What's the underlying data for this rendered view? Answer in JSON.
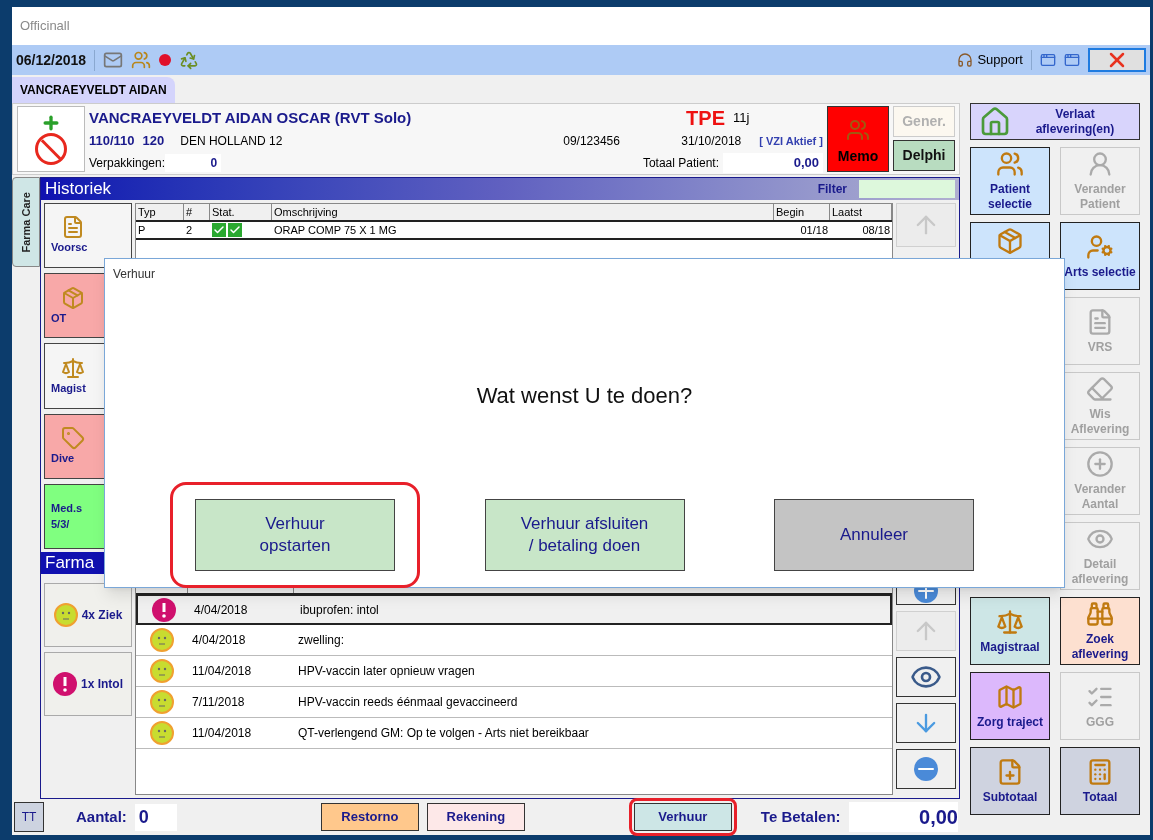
{
  "window": {
    "title": "Officinall"
  },
  "toolbar": {
    "date": "06/12/2018",
    "support": "Support"
  },
  "patient_tab": {
    "label": "VANCRAEYVELDT AIDAN",
    "selected": true
  },
  "patient": {
    "name": "VANCRAEYVELDT AIDAN OSCAR (RVT Solo)",
    "badge": "TPE",
    "age": "11j",
    "code_1": "110/110",
    "code_2": "120",
    "address": "DEN HOLLAND 12",
    "number": "09/123456",
    "date": "31/10/2018",
    "status": "[ VZI Aktief ]",
    "packages_label": "Verpakkingen:",
    "packages": "0",
    "total_label": "Totaal Patient:",
    "total": "0,00"
  },
  "header_buttons": [
    {
      "label": "Memo",
      "kind": "memo",
      "disabled": false
    },
    {
      "label": "Gener.",
      "kind": "plain",
      "disabled": true
    },
    {
      "label": "Delphi",
      "kind": "plain",
      "disabled": false
    }
  ],
  "side_tab": {
    "label": "Farma Care"
  },
  "historiek": {
    "title": "Historiek",
    "filter_label": "Filter",
    "buttons": [
      {
        "label": "Voorsc",
        "color": "#f5f5f5"
      },
      {
        "label": "OT",
        "color": "#f8a8a8"
      },
      {
        "label": "Magist",
        "color": "#f5f5f5"
      },
      {
        "label": "Dive",
        "color": "#f8a8a8"
      },
      {
        "label": "Med.s\n5/3/",
        "color": "#80ff80"
      }
    ],
    "columns": [
      "Typ",
      "#",
      "Stat.",
      "Omschrijving",
      "Begin",
      "Laatst"
    ],
    "rows": [
      {
        "typ": "P",
        "count": "2",
        "status_ok": true,
        "description": "ORAP COMP  75 X 1 MG",
        "begin": "01/18",
        "last": "08/18"
      }
    ]
  },
  "farma": {
    "title": "Farma",
    "buttons": [
      {
        "label": "4x Ziek",
        "kind": "sick"
      },
      {
        "label": "1x Intol",
        "kind": "intolerance"
      }
    ],
    "rows": [
      {
        "kind": "intolerance",
        "date": "4/04/2018",
        "text": "ibuprofen: intol",
        "selected": true
      },
      {
        "kind": "sick",
        "date": "4/04/2018",
        "text": "zwelling:",
        "selected": false
      },
      {
        "kind": "sick",
        "date": "11/04/2018",
        "text": "HPV-vaccin later opnieuw vragen",
        "selected": false
      },
      {
        "kind": "sick",
        "date": "7/11/2018",
        "text": "HPV-vaccin reeds éénmaal gevaccineerd",
        "selected": false
      },
      {
        "kind": "sick",
        "date": "11/04/2018",
        "text": "QT-verlengend GM: Op te volgen - Arts niet bereikbaar",
        "selected": false
      }
    ]
  },
  "right_panel": {
    "top": {
      "label": "Verlaat aflevering(en)",
      "color": "#d8d4fc",
      "disabled": false
    },
    "left_top": [
      {
        "label": "Patient selectie",
        "color": "#cde4fc",
        "disabled": false
      },
      {
        "color": "#cde4fc",
        "disabled": false
      }
    ],
    "left_bottom": [
      {
        "label": "Magistraal",
        "color": "#cde6e6",
        "disabled": false
      },
      {
        "label": "Zorg traject",
        "color": "#dcb8fc",
        "disabled": false
      },
      {
        "label": "Subtotaal",
        "color": "#cfd3e0",
        "disabled": false
      }
    ],
    "right": [
      {
        "label": "Verander Patient",
        "color": "#f0f0f0",
        "disabled": true
      },
      {
        "label": "Arts selectie",
        "color": "#cde4fc",
        "disabled": false
      },
      {
        "label": "VRS",
        "color": "#f0f0f0",
        "disabled": true
      },
      {
        "label": "Wis Aflevering",
        "color": "#f0f0f0",
        "disabled": true
      },
      {
        "label": "Verander Aantal",
        "color": "#f0f0f0",
        "disabled": true
      },
      {
        "label": "Detail aflevering",
        "color": "#f0f0f0",
        "disabled": true
      },
      {
        "label": "Zoek aflevering",
        "color": "#fde0d0",
        "disabled": false
      },
      {
        "label": "GGG",
        "color": "#f0f0f0",
        "disabled": true
      },
      {
        "label": "Totaal",
        "color": "#cfd3e0",
        "disabled": false
      }
    ]
  },
  "bottom_bar": {
    "tt": "TT",
    "count_label": "Aantal:",
    "count": "0",
    "buttons": [
      {
        "label": "Restorno",
        "color": "#ffc88c",
        "highlighted": false
      },
      {
        "label": "Rekening",
        "color": "#fde8e8",
        "highlighted": false
      },
      {
        "label": "Verhuur",
        "color": "#cde6e6",
        "highlighted": true
      }
    ],
    "pay_label": "Te Betalen:",
    "pay": "0,00"
  },
  "dialog": {
    "title": "Verhuur",
    "question": "Wat wenst U te doen?",
    "buttons": [
      {
        "label": "Verhuur\nopstarten",
        "color": "#c8e6c8",
        "highlighted": true
      },
      {
        "label": "Verhuur afsluiten\n/ betaling doen",
        "color": "#c8e6c8",
        "highlighted": false
      },
      {
        "label": "Annuleer",
        "color": "#c4c4c4",
        "highlighted": false
      }
    ]
  }
}
